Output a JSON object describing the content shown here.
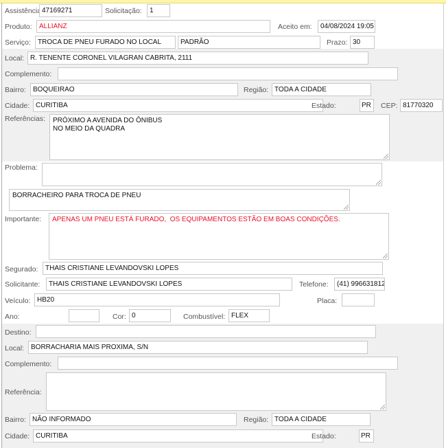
{
  "header": {
    "assistencia_label": "Assistência:",
    "assistencia": "47169271",
    "solicitacao_label": "Solicitação:",
    "solicitacao": "1",
    "produto_label": "Produto:",
    "produto": "ALLIANZ",
    "aceito_label": "Aceito em:",
    "aceito": "04/08/2024 19:05",
    "servico_label": "Serviço:",
    "servico": "TROCA DE PNEU FURADO NO LOCAL",
    "servico_tipo": "PADRÃO",
    "prazo_label": "Prazo:",
    "prazo": "30"
  },
  "origem": {
    "local_label": "Local:",
    "local": "R. TENENTE CORONEL VILAGRAN CABRITA, 2111",
    "complemento_label": "Complemento:",
    "complemento": "",
    "bairro_label": "Bairro:",
    "bairro": "BOQUEIRAO",
    "regiao_label": "Região:",
    "regiao": "TODA A CIDADE",
    "cidade_label": "Cidade:",
    "cidade": "CURITIBA",
    "estado_label": "Estado:",
    "estado": "PR",
    "cep_label": "CEP:",
    "cep": "81770320",
    "referencias_label": "Referências:",
    "referencias": "PRÓXIMO A AVENIDA DO ÔNIBUS\nNO MEIO DA QUADRA"
  },
  "detalhes": {
    "problema_label": "Problema:",
    "problema": "",
    "descricao": "BORRACHEIRO PARA TROCA DE PNEU",
    "importante_label": "Importante:",
    "importante": "APENAS UM PNEU ESTÁ FURADO,  OS EQUIPAMENTOS ESTÃO EM BOAS CONDIÇÕES.",
    "segurado_label": "Segurado:",
    "segurado": "THAIS CRISTIANE LEVANDOVSKI LOPES",
    "solicitante_label": "Solicitante:",
    "solicitante": "THAIS CRISTIANE LEVANDOVSKI LOPES",
    "telefone_label": "Telefone:",
    "telefone": "(41) 996631812",
    "veiculo_label": "Veículo:",
    "veiculo": "HB20",
    "placa_label": "Placa:",
    "placa": "",
    "ano_label": "Ano:",
    "ano": "",
    "cor_label": "Cor:",
    "cor": "0",
    "combustivel_label": "Combustível:",
    "combustivel": "FLEX"
  },
  "destino": {
    "destino_label": "Destino:",
    "destino": "",
    "local_label": "Local:",
    "local": "BORRACHARIA MAIS PROXIMA, S/N",
    "complemento_label": "Complemento:",
    "complemento": "",
    "referencia_label": "Referência:",
    "referencia": "",
    "bairro_label": "Bairro:",
    "bairro": "NÃO INFORMADO",
    "regiao_label": "Região:",
    "regiao": "TODA A CIDADE",
    "cidade_label": "Cidade:",
    "cidade": "CURITIBA",
    "estado_label": "Estado:",
    "estado": "PR"
  },
  "colors": {
    "highlight_text": "#e8122a",
    "band_gray": "#f0f0f0"
  }
}
